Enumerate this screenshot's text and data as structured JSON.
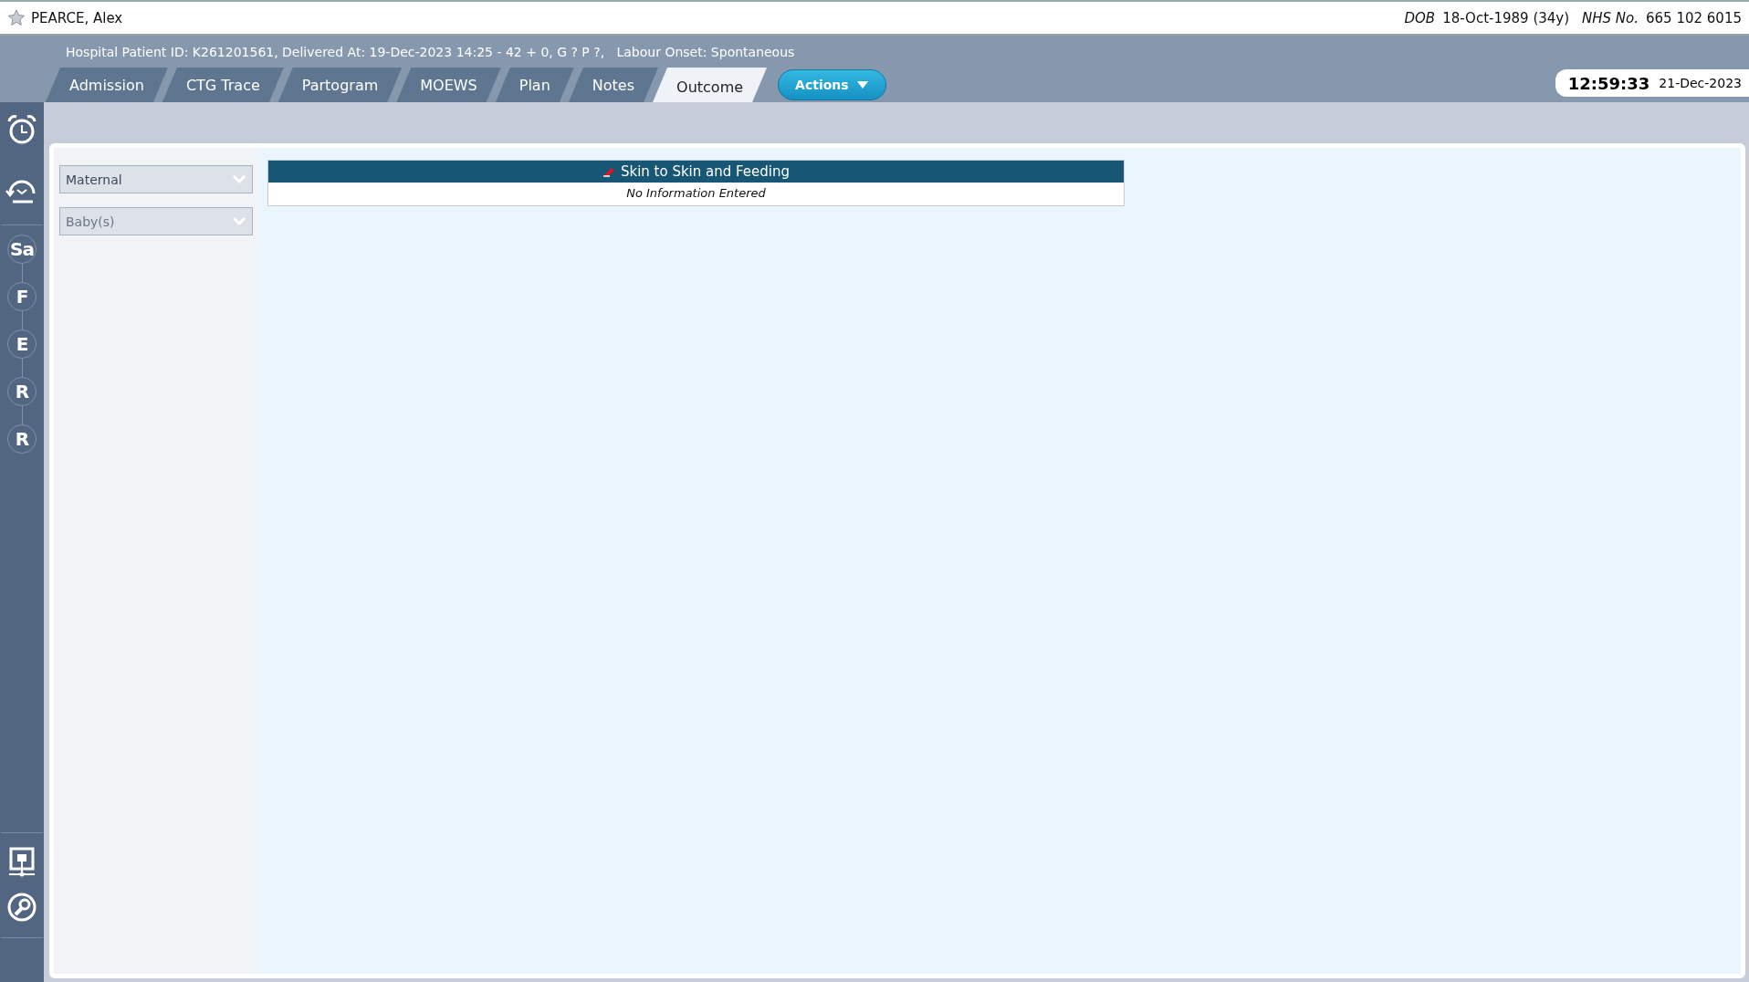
{
  "patient": {
    "name": "PEARCE, Alex",
    "dob_label": "DOB",
    "dob": "18-Oct-1989 (34y)",
    "nhs_label": "NHS No.",
    "nhs_number": "665 102 6015"
  },
  "info_line": "Hospital Patient ID: K261201561, Delivered At: 19-Dec-2023 14:25 - 42 + 0, G ? P ?,   Labour Onset: Spontaneous",
  "tabs": [
    {
      "label": "Admission",
      "selected": false
    },
    {
      "label": "CTG Trace",
      "selected": false
    },
    {
      "label": "Partogram",
      "selected": false
    },
    {
      "label": "MOEWS",
      "selected": false
    },
    {
      "label": "Plan",
      "selected": false
    },
    {
      "label": "Notes",
      "selected": false
    },
    {
      "label": "Outcome",
      "selected": true
    }
  ],
  "actions_button": {
    "label": "Actions"
  },
  "clock": {
    "time": "12:59:33",
    "date": "21-Dec-2023"
  },
  "side_rail": {
    "steps": [
      "Sa",
      "F",
      "E",
      "R",
      "R"
    ]
  },
  "filters": [
    {
      "label": "Maternal",
      "disabled": false
    },
    {
      "label": "Baby(s)",
      "disabled": true
    }
  ],
  "section": {
    "title": "Skin to Skin and Feeding",
    "body": "No Information Entered"
  }
}
